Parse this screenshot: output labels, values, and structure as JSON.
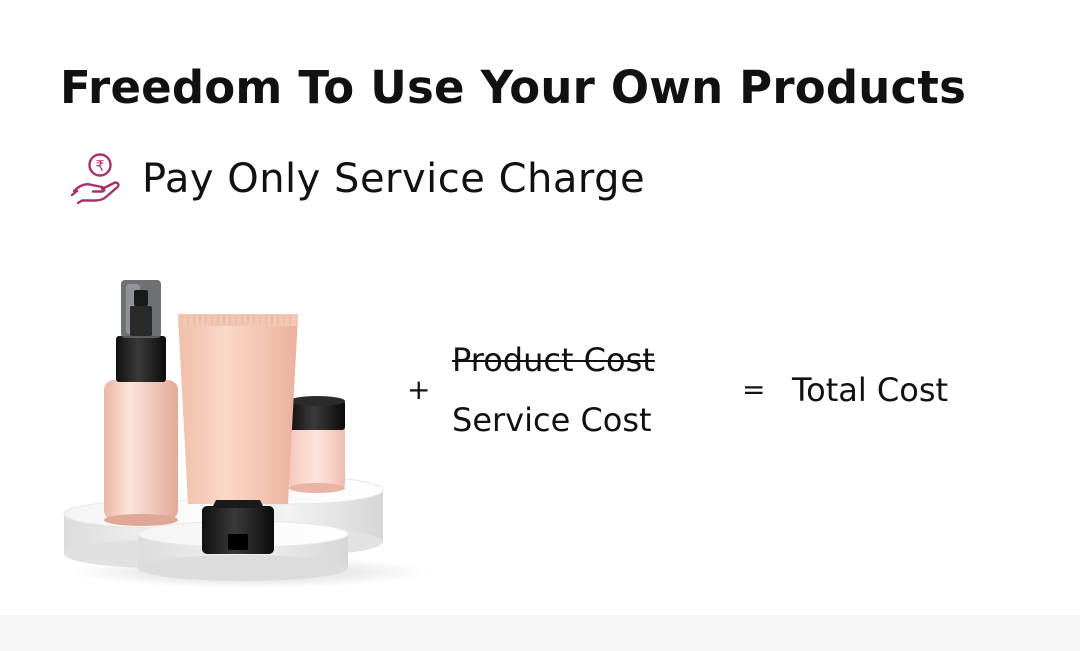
{
  "heading": {
    "title": "Freedom To Use Your Own Products"
  },
  "feature": {
    "icon": "hand-rupee-icon",
    "label": "Pay Only Service Charge"
  },
  "equation": {
    "plus": "+",
    "product_cost": "Product Cost",
    "service_cost": "Service Cost",
    "equals": "=",
    "total_cost": "Total Cost"
  },
  "colors": {
    "accent": "#a3336a",
    "text": "#111111",
    "product_pink": "#f2c4b2"
  },
  "illustration": {
    "icon": "cosmetic-products-icon"
  }
}
